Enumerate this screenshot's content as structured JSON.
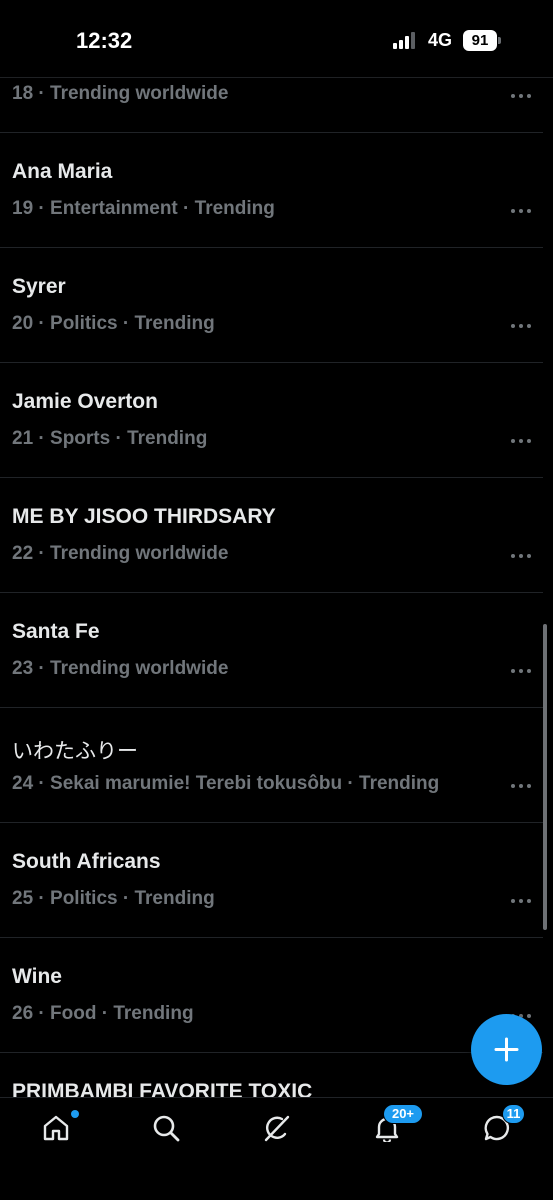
{
  "status": {
    "time": "12:32",
    "network": "4G",
    "battery": "91"
  },
  "trends": [
    {
      "title": "",
      "meta": "18 · Trending worldwide"
    },
    {
      "title": "Ana Maria",
      "meta": "19 · Entertainment · Trending"
    },
    {
      "title": "Syrer",
      "meta": "20 · Politics · Trending"
    },
    {
      "title": "Jamie Overton",
      "meta": "21 · Sports · Trending"
    },
    {
      "title": "ME BY JISOO THIRDSARY",
      "meta": "22 · Trending worldwide"
    },
    {
      "title": "Santa Fe",
      "meta": "23 · Trending worldwide"
    },
    {
      "title": "いわたふりー",
      "meta": "24 · Sekai marumie! Terebi tokusôbu · Trending"
    },
    {
      "title": "South Africans",
      "meta": "25 · Politics · Trending"
    },
    {
      "title": "Wine",
      "meta": "26 · Food · Trending"
    },
    {
      "title": "PRIMBAMBI FAVORITE TOXIC",
      "meta": ""
    }
  ],
  "tabbar": {
    "notifications_badge": "20+",
    "messages_badge": "11"
  },
  "icons": {
    "home": "home-icon",
    "search": "search-icon",
    "grok": "grok-icon",
    "notifications": "bell-icon",
    "messages": "messages-icon",
    "compose": "plus-icon"
  },
  "colors": {
    "accent": "#1d9bf0",
    "secondary_text": "#71767b",
    "divider": "#202327"
  }
}
